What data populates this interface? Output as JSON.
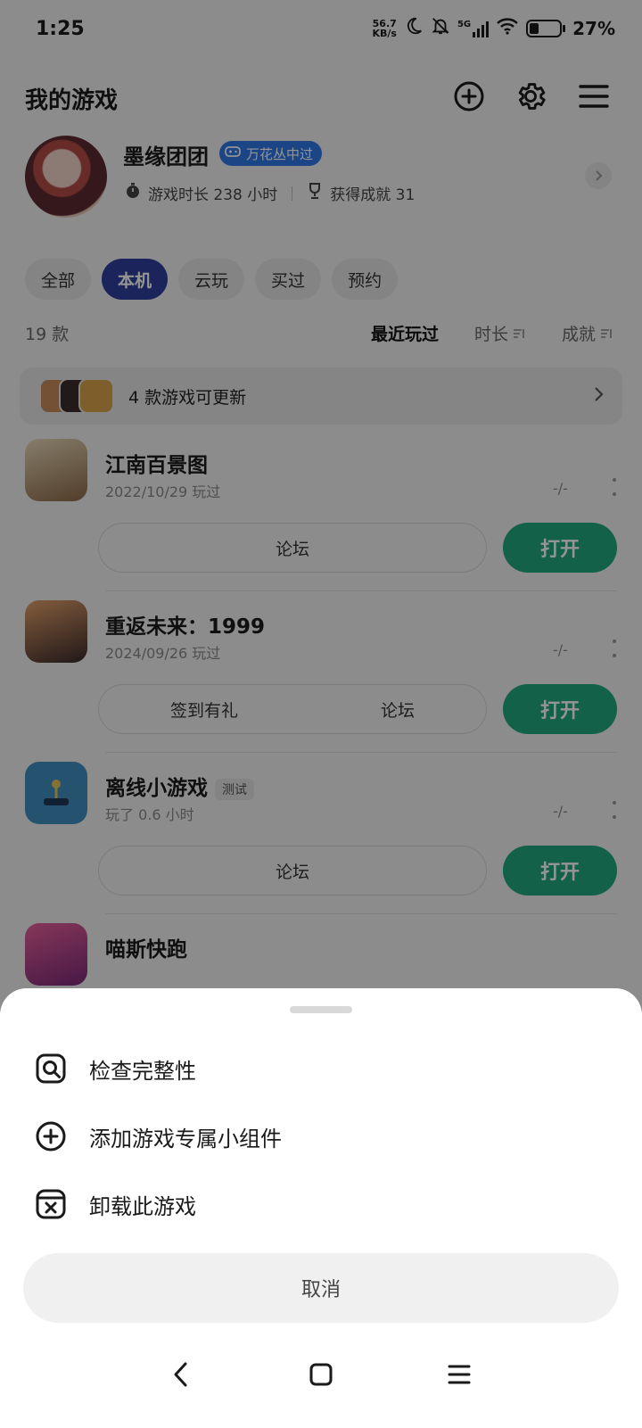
{
  "status_bar": {
    "time": "1:25",
    "net_speed_value": "56.7",
    "net_speed_unit": "KB/s",
    "network": "5G",
    "battery": "27%"
  },
  "header": {
    "title": "我的游戏"
  },
  "profile": {
    "username": "墨缘团团",
    "badge": "万花丛中过",
    "playtime": "游戏时长 238 小时",
    "achievements": "获得成就 31"
  },
  "tabs": [
    {
      "label": "全部",
      "active": false
    },
    {
      "label": "本机",
      "active": true
    },
    {
      "label": "云玩",
      "active": false
    },
    {
      "label": "买过",
      "active": false
    },
    {
      "label": "预约",
      "active": false
    }
  ],
  "list": {
    "count": "19 款",
    "sorts": [
      {
        "label": "最近玩过",
        "active": true
      },
      {
        "label": "时长",
        "active": false
      },
      {
        "label": "成就",
        "active": false
      }
    ],
    "update_banner": "4 款游戏可更新"
  },
  "games": [
    {
      "name": "江南百景图",
      "tag": "",
      "sub": "2022/10/29 玩过",
      "score": "-/-",
      "actions": [
        "论坛"
      ],
      "open": "打开",
      "icon_color": "#c9a774"
    },
    {
      "name": "重返未来：1999",
      "tag": "",
      "sub": "2024/09/26 玩过",
      "score": "-/-",
      "actions": [
        "签到有礼",
        "论坛"
      ],
      "open": "打开",
      "icon_color": "#b0653a"
    },
    {
      "name": "离线小游戏",
      "tag": "测试",
      "sub": "玩了 0.6 小时",
      "score": "-/-",
      "actions": [
        "论坛"
      ],
      "open": "打开",
      "icon_color": "#3a86b8"
    },
    {
      "name": "喵斯快跑",
      "tag": "",
      "sub": "",
      "score": "",
      "actions": [],
      "open": "",
      "icon_color": "#d24a86"
    }
  ],
  "sheet": {
    "items": [
      {
        "label": "检查完整性",
        "icon": "search-integrity-icon"
      },
      {
        "label": "添加游戏专属小组件",
        "icon": "add-widget-icon"
      },
      {
        "label": "卸载此游戏",
        "icon": "uninstall-icon"
      }
    ],
    "cancel": "取消"
  },
  "colors": {
    "accent_green": "#1fa77c",
    "tab_active": "#2f3e9e",
    "badge_blue": "#2f77e6"
  }
}
